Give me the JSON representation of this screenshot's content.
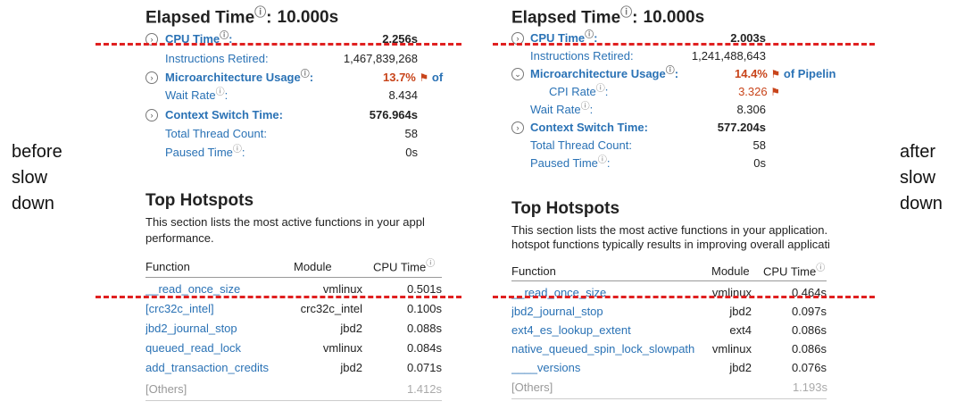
{
  "before": {
    "elapsed_label": "Elapsed Time",
    "elapsed_value": "10.000s",
    "metrics": {
      "cpu_time_label": "CPU Time",
      "cpu_time_value": "2.256s",
      "instructions_label": "Instructions Retired:",
      "instructions_value": "1,467,839,268",
      "micro_label": "Microarchitecture Usage",
      "micro_value": "13.7%",
      "micro_suffix": "of",
      "wait_label": "Wait Rate",
      "wait_value": "8.434",
      "ctx_label": "Context Switch Time:",
      "ctx_value": "576.964s",
      "thread_label": "Total Thread Count:",
      "thread_value": "58",
      "paused_label": "Paused Time",
      "paused_value": "0s"
    },
    "hotspots_title": "Top Hotspots",
    "hotspots_desc_1": "This section lists the most active functions in your appl",
    "hotspots_desc_2": "performance.",
    "table": {
      "col_function": "Function",
      "col_module": "Module",
      "col_cpu": "CPU Time",
      "rows": [
        {
          "function": "__read_once_size",
          "module": "vmlinux",
          "cpu": "0.501s"
        },
        {
          "function": "[crc32c_intel]",
          "module": "crc32c_intel",
          "cpu": "0.100s"
        },
        {
          "function": "jbd2_journal_stop",
          "module": "jbd2",
          "cpu": "0.088s"
        },
        {
          "function": "queued_read_lock",
          "module": "vmlinux",
          "cpu": "0.084s"
        },
        {
          "function": "add_transaction_credits",
          "module": "jbd2",
          "cpu": "0.071s"
        }
      ],
      "others_label": "[Others]",
      "others_value": "1.412s"
    }
  },
  "after": {
    "elapsed_label": "Elapsed Time",
    "elapsed_value": "10.000s",
    "metrics": {
      "cpu_time_label": "CPU Time",
      "cpu_time_value": "2.003s",
      "instructions_label": "Instructions Retired:",
      "instructions_value": "1,241,488,643",
      "micro_label": "Microarchitecture Usage",
      "micro_value": "14.4%",
      "micro_suffix": "of Pipelin",
      "cpi_label": "CPI Rate",
      "cpi_value": "3.326",
      "wait_label": "Wait Rate",
      "wait_value": "8.306",
      "ctx_label": "Context Switch Time:",
      "ctx_value": "577.204s",
      "thread_label": "Total Thread Count:",
      "thread_value": "58",
      "paused_label": "Paused Time",
      "paused_value": "0s"
    },
    "hotspots_title": "Top Hotspots",
    "hotspots_desc_1": "This section lists the most active functions in your application.",
    "hotspots_desc_2": "hotspot functions typically results in improving overall applicati",
    "table": {
      "col_function": "Function",
      "col_module": "Module",
      "col_cpu": "CPU Time",
      "rows": [
        {
          "function": "__read_once_size",
          "module": "vmlinux",
          "cpu": "0.464s"
        },
        {
          "function": "jbd2_journal_stop",
          "module": "jbd2",
          "cpu": "0.097s"
        },
        {
          "function": "ext4_es_lookup_extent",
          "module": "ext4",
          "cpu": "0.086s"
        },
        {
          "function": "native_queued_spin_lock_slowpath",
          "module": "vmlinux",
          "cpu": "0.086s"
        },
        {
          "function": "____versions",
          "module": "jbd2",
          "cpu": "0.076s"
        }
      ],
      "others_label": "[Others]",
      "others_value": "1.193s"
    }
  },
  "annotations": {
    "before_line1": "before",
    "before_line2": "slow",
    "before_line3": "down",
    "after_line1": "after",
    "after_line2": "slow",
    "after_line3": "down",
    "dash_color": "#e02020"
  },
  "icons": {
    "help": "question-circle-icon",
    "expander_collapsed": "chevron-right-circle-icon",
    "expander_expanded": "chevron-down-circle-icon",
    "flag": "warning-flag-icon"
  }
}
